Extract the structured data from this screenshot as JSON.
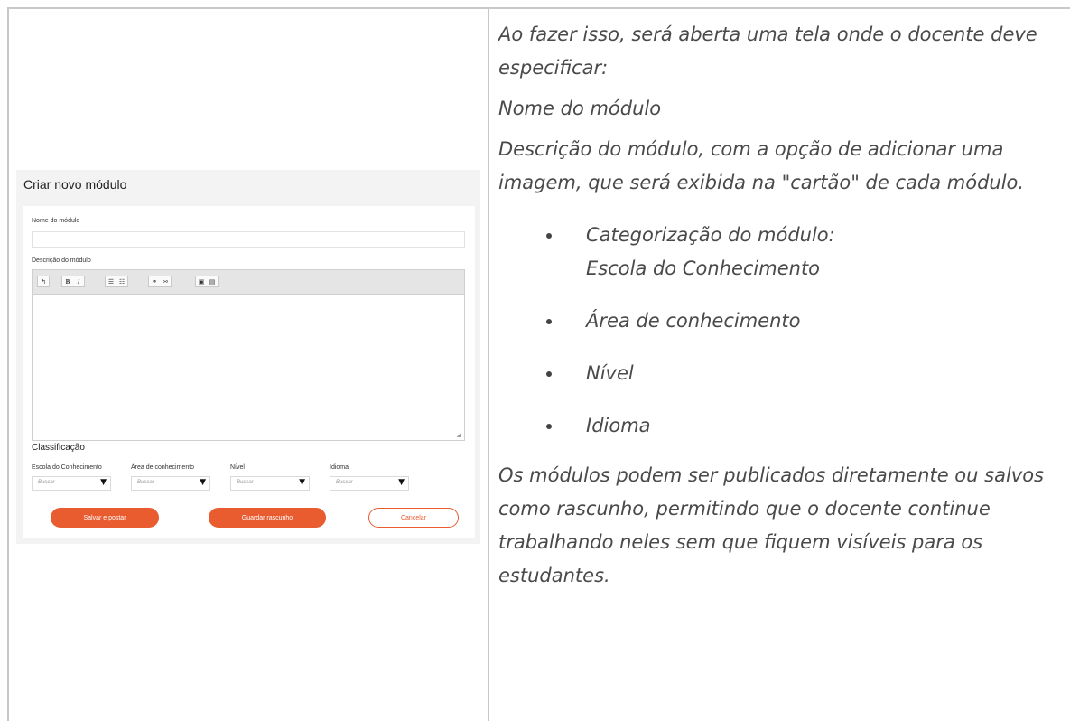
{
  "form": {
    "title": "Criar novo módulo",
    "name_label": "Nome do módulo",
    "name_value": "",
    "description_label": "Descrição do módulo",
    "toolbar_buttons": [
      {
        "icon": "undo-icon",
        "glyph": "↰"
      },
      {
        "icon": "bold-icon",
        "glyph": "B"
      },
      {
        "icon": "italic-icon",
        "glyph": "I"
      },
      {
        "icon": "bullet-list-icon",
        "glyph": "☰"
      },
      {
        "icon": "numbered-list-icon",
        "glyph": "☷"
      },
      {
        "icon": "link-icon",
        "glyph": "⚭"
      },
      {
        "icon": "unlink-icon",
        "glyph": "⚯"
      },
      {
        "icon": "image-icon",
        "glyph": "▣"
      },
      {
        "icon": "file-icon",
        "glyph": "▤"
      }
    ],
    "classification_heading": "Classificação",
    "selects": [
      {
        "label": "Escola do Conhecimento",
        "placeholder": "Buscar"
      },
      {
        "label": "Área de conhecimento",
        "placeholder": "Buscar"
      },
      {
        "label": "Nível",
        "placeholder": "Buscar"
      },
      {
        "label": "Idioma",
        "placeholder": "Buscar"
      }
    ],
    "buttons": {
      "save_post": "Salvar e postar",
      "save_draft": "Guardar rascunho",
      "cancel": "Cancelar"
    },
    "accent_color": "#e95c30"
  },
  "text": {
    "intro": "Ao fazer isso, será aberta uma tela onde o docente deve especificar:",
    "item_name": "Nome do módulo",
    "item_description": "Descrição do módulo, com a opção de adicionar uma imagem, que será exibida na \"cartão\" de cada módulo.",
    "bullets": [
      {
        "line1": "Categorização do módulo:",
        "line2": "Escola do Conhecimento"
      },
      {
        "line1": "Área de conhecimento",
        "line2": ""
      },
      {
        "line1": "Nível",
        "line2": ""
      },
      {
        "line1": "Idioma",
        "line2": ""
      }
    ],
    "closing": "Os módulos podem ser publicados diretamente ou salvos como rascunho, permitindo que o docente continue trabalhando neles sem que fiquem visíveis para os estudantes."
  }
}
